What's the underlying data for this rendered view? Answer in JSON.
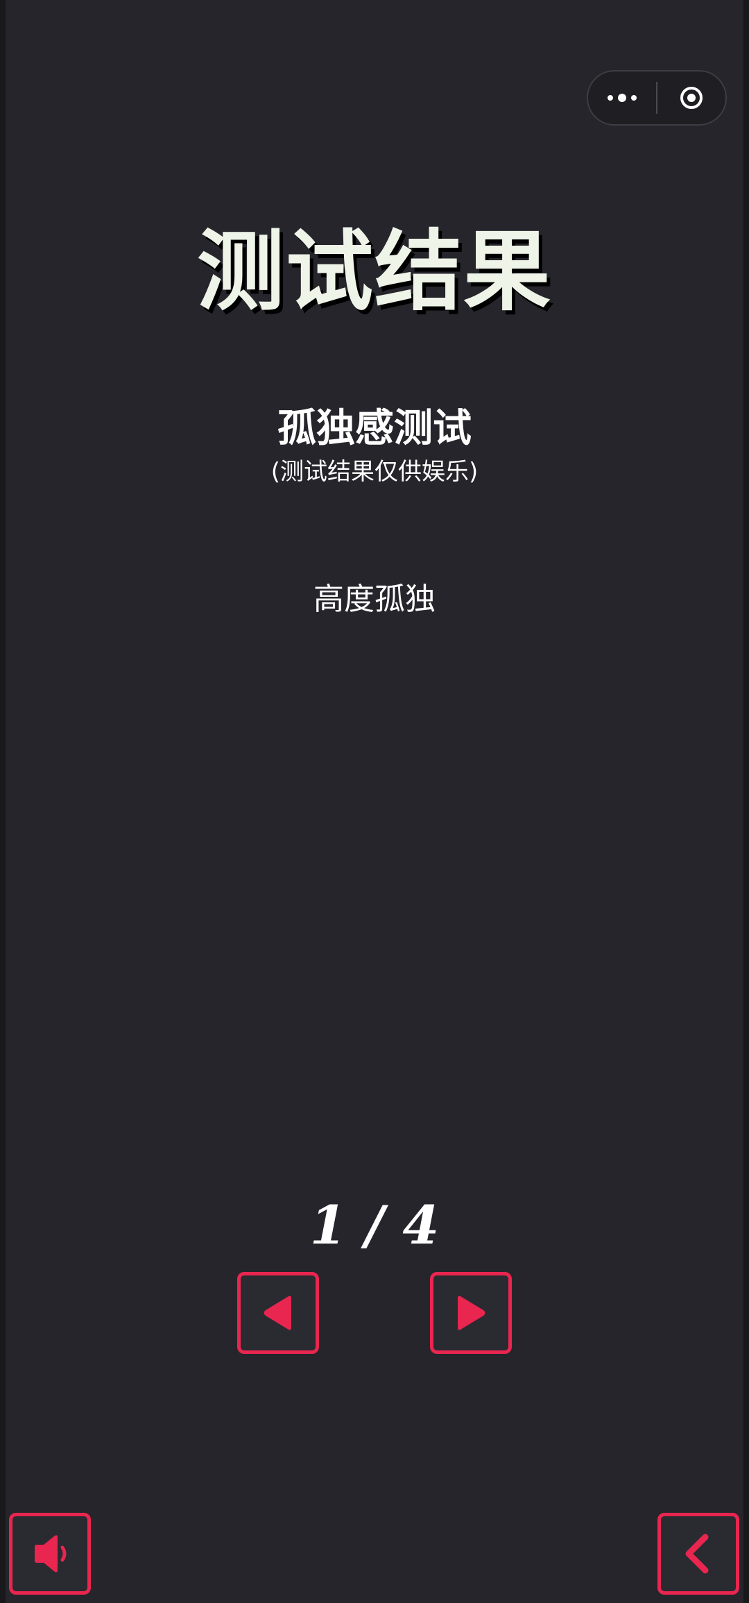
{
  "capsule": {
    "more_icon": "more-dots-icon",
    "close_icon": "target-circle-icon"
  },
  "page": {
    "title": "测试结果",
    "test_name": "孤独感测试",
    "disclaimer": "(测试结果仅供娱乐)",
    "result": "高度孤独"
  },
  "pagination": {
    "current": 1,
    "total": 4,
    "label": "1 / 4",
    "prev_icon": "triangle-left-icon",
    "next_icon": "triangle-right-icon"
  },
  "footer": {
    "sound_icon": "speaker-icon",
    "back_icon": "chevron-left-icon"
  },
  "colors": {
    "background": "#25252b",
    "outer_background": "#19191c",
    "accent": "#e8264f",
    "title_text": "#eef4e8",
    "text": "#ffffff"
  }
}
